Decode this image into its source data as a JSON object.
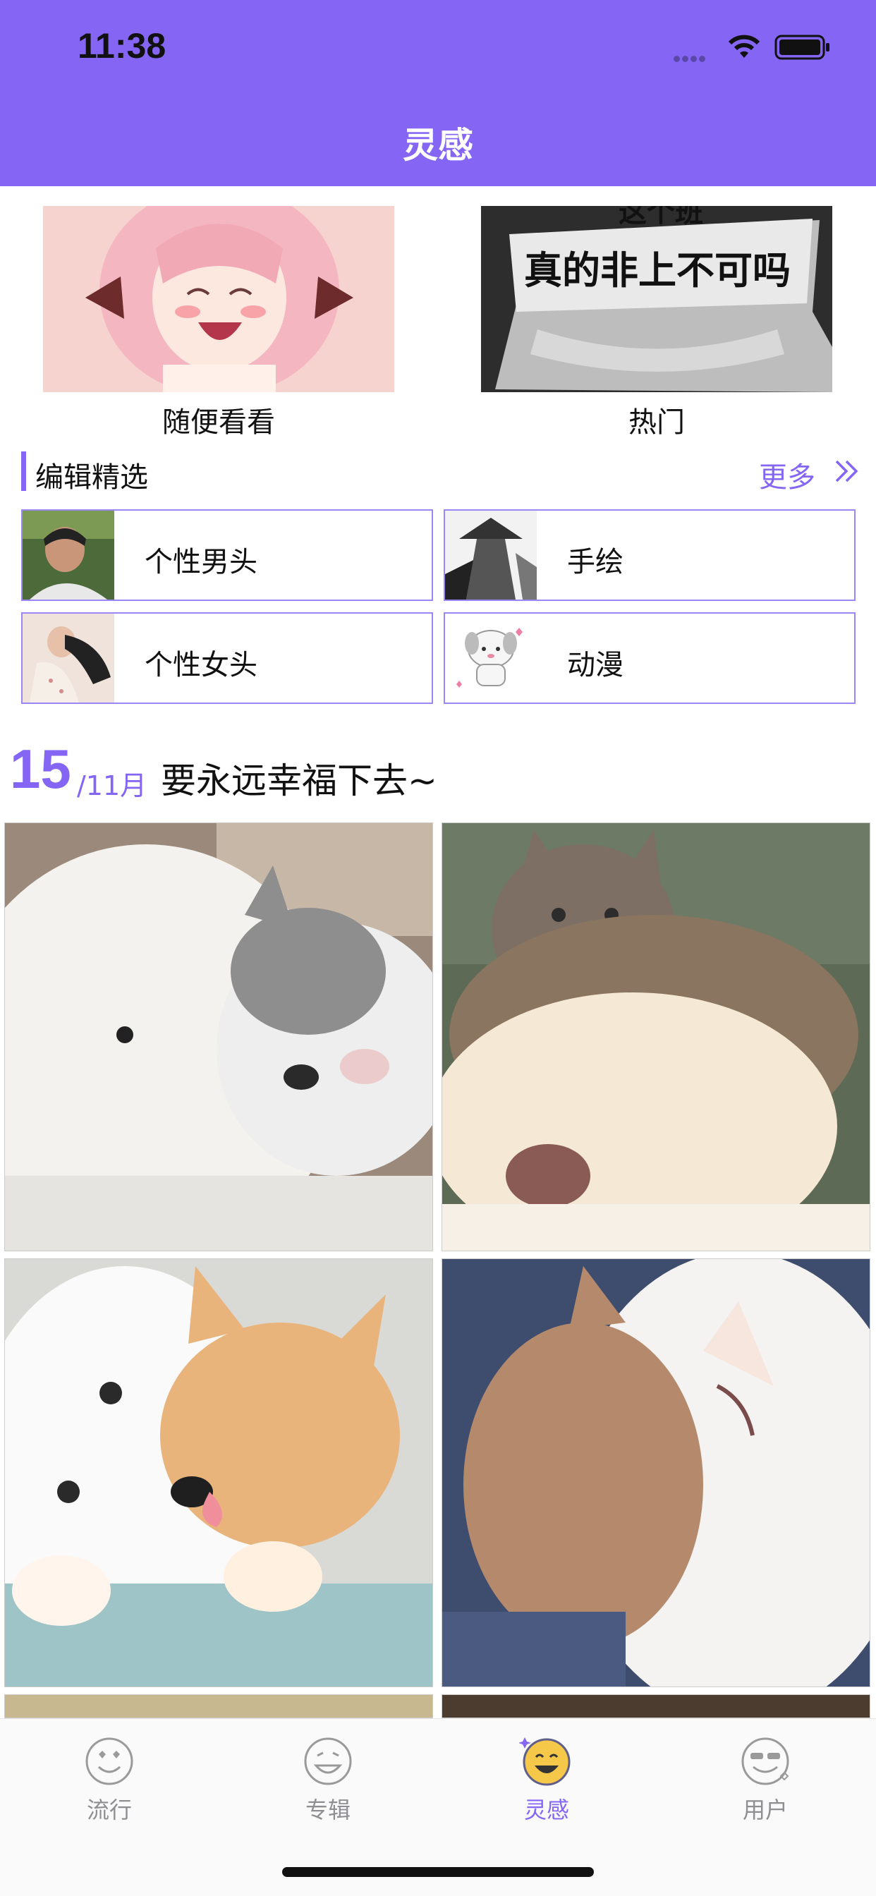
{
  "status_bar": {
    "time": "11:38"
  },
  "nav": {
    "title": "灵感"
  },
  "features": [
    {
      "label": "随便看看",
      "image": "anime-girl-smiling"
    },
    {
      "label": "热门",
      "image": "paper-sign-text"
    }
  ],
  "section": {
    "title": "编辑精选",
    "more_label": "更多"
  },
  "categories": [
    {
      "label": "个性男头",
      "image": "man-portrait"
    },
    {
      "label": "手绘",
      "image": "ink-warrior"
    },
    {
      "label": "个性女头",
      "image": "woman-reclining"
    },
    {
      "label": "动漫",
      "image": "cartoon-dog"
    }
  ],
  "daily": {
    "day": "15",
    "month": "/11月",
    "text": "要永远幸福下去~"
  },
  "photos": [
    "samoyed-with-grey-cat",
    "tabby-cat-on-samoyed",
    "samoyed-licking-orange-cat",
    "cat-nuzzling-samoyed"
  ],
  "tabs": [
    {
      "label": "流行",
      "icon": "heart-eyes-face-icon",
      "active": false
    },
    {
      "label": "专辑",
      "icon": "smile-face-icon",
      "active": false
    },
    {
      "label": "灵感",
      "icon": "grin-face-icon",
      "active": true
    },
    {
      "label": "用户",
      "icon": "cool-face-icon",
      "active": false
    }
  ],
  "colors": {
    "accent": "#8566f4"
  }
}
